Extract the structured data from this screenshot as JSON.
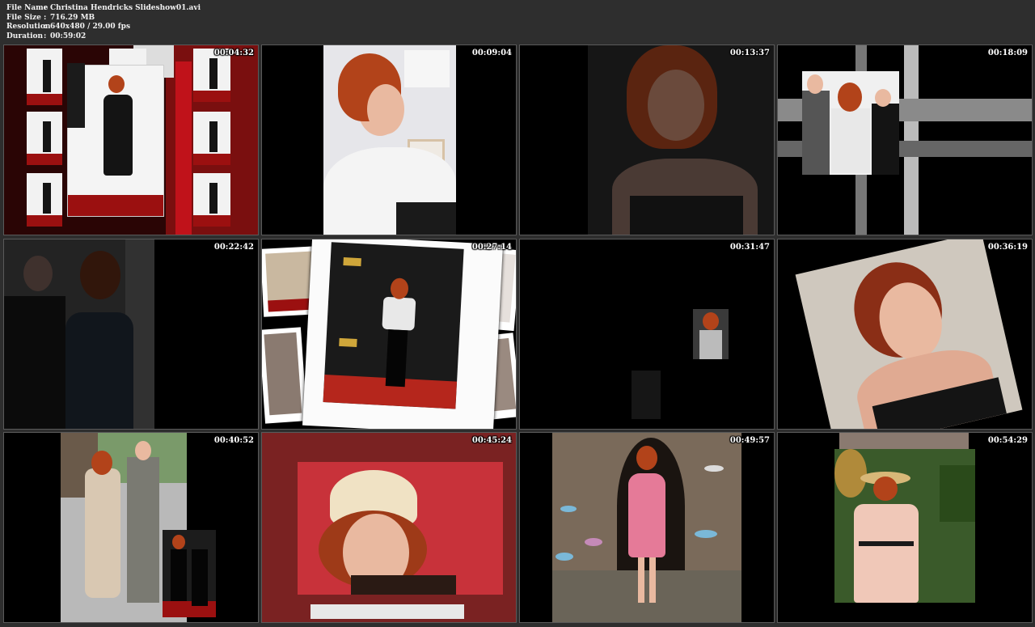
{
  "info": {
    "file_name_label": "File Name",
    "file_name": "Christina Hendricks Slideshow01.avi",
    "file_size_label": "File Size",
    "file_size": "716.29 MB",
    "resolution_label": "Resolution",
    "resolution": "640x480 / 29.00 fps",
    "duration_label": "Duration",
    "duration": "00:59:02",
    "separator": ":"
  },
  "thumbnails": [
    {
      "timestamp": "00:04:32"
    },
    {
      "timestamp": "00:09:04"
    },
    {
      "timestamp": "00:13:37"
    },
    {
      "timestamp": "00:18:09"
    },
    {
      "timestamp": "00:22:42"
    },
    {
      "timestamp": "00:27:14"
    },
    {
      "timestamp": "00:31:47"
    },
    {
      "timestamp": "00:36:19"
    },
    {
      "timestamp": "00:40:52"
    },
    {
      "timestamp": "00:45:24"
    },
    {
      "timestamp": "00:49:57"
    },
    {
      "timestamp": "00:54:29"
    }
  ],
  "colors": {
    "background": "#2e2e2e",
    "frame": "#000000",
    "text": "#ffffff"
  }
}
